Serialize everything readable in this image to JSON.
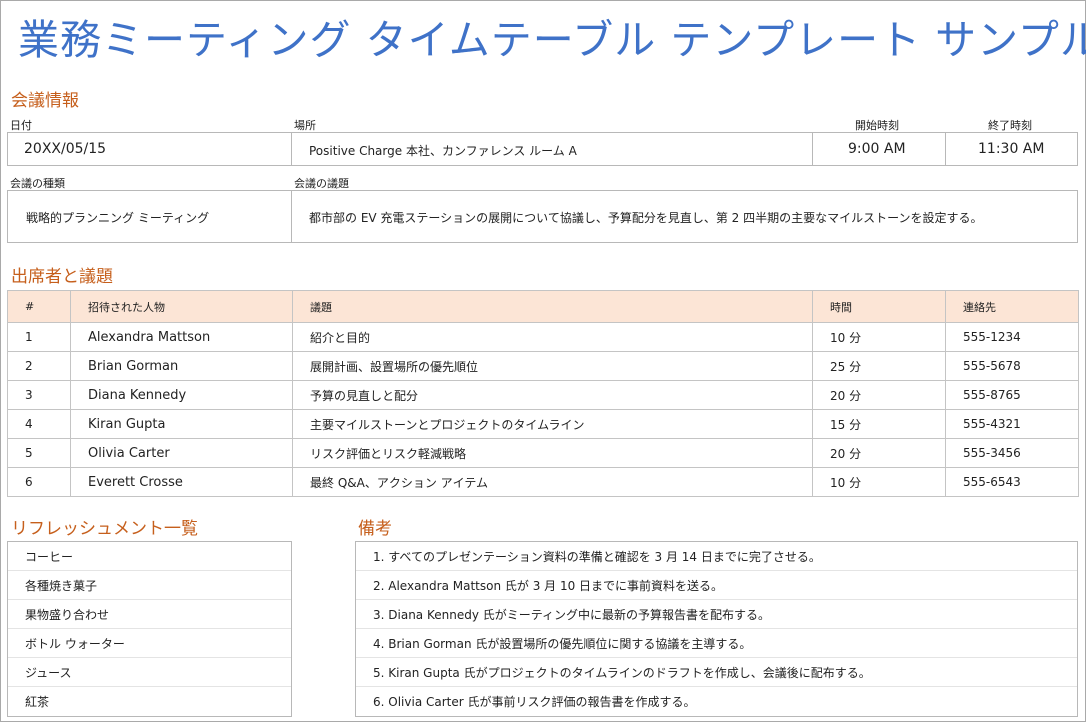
{
  "title": "業務ミーティング タイムテーブル テンプレート サンプル",
  "meeting_info": {
    "heading": "会議情報",
    "date_label": "日付",
    "date": "20XX/05/15",
    "location_label": "場所",
    "location": "Positive Charge 本社、カンファレンス ルーム A",
    "start_label": "開始時刻",
    "start": "9:00 AM",
    "end_label": "終了時刻",
    "end": "11:30 AM",
    "type_label": "会議の種類",
    "type": "戦略的プランニング ミーティング",
    "agenda_label": "会議の議題",
    "agenda": "都市部の EV 充電ステーションの展開について協議し、予算配分を見直し、第 2 四半期の主要なマイルストーンを設定する。"
  },
  "attendees": {
    "heading": "出席者と議題",
    "headers": [
      "#",
      "招待された人物",
      "議題",
      "時間",
      "連絡先"
    ],
    "rows": [
      {
        "num": "1",
        "person": "Alexandra Mattson",
        "topic": "紹介と目的",
        "time": "10 分",
        "contact": "555-1234"
      },
      {
        "num": "2",
        "person": "Brian Gorman",
        "topic": "展開計画、設置場所の優先順位",
        "time": "25 分",
        "contact": "555-5678"
      },
      {
        "num": "3",
        "person": "Diana Kennedy",
        "topic": "予算の見直しと配分",
        "time": "20 分",
        "contact": "555-8765"
      },
      {
        "num": "4",
        "person": "Kiran Gupta",
        "topic": "主要マイルストーンとプロジェクトのタイムライン",
        "time": "15 分",
        "contact": "555-4321"
      },
      {
        "num": "5",
        "person": "Olivia Carter",
        "topic": "リスク評価とリスク軽減戦略",
        "time": "20 分",
        "contact": "555-3456"
      },
      {
        "num": "6",
        "person": "Everett Crosse",
        "topic": "最終 Q&A、アクション アイテム",
        "time": "10 分",
        "contact": "555-6543"
      }
    ]
  },
  "refreshments": {
    "heading": "リフレッシュメント一覧",
    "items": [
      "コーヒー",
      "各種焼き菓子",
      "果物盛り合わせ",
      "ボトル ウォーター",
      "ジュース",
      "紅茶"
    ]
  },
  "notes": {
    "heading": "備考",
    "items": [
      "1. すべてのプレゼンテーション資料の準備と確認を 3 月 14 日までに完了させる。",
      "2. Alexandra Mattson 氏が 3 月 10 日までに事前資料を送る。",
      "3. Diana Kennedy 氏がミーティング中に最新の予算報告書を配布する。",
      "4. Brian Gorman 氏が設置場所の優先順位に関する協議を主導する。",
      "5. Kiran Gupta 氏がプロジェクトのタイムラインのドラフトを作成し、会議後に配布する。",
      "6. Olivia Carter 氏が事前リスク評価の報告書を作成する。"
    ]
  },
  "colors": {
    "title": "#3f72c8",
    "section_heading": "#c65f1c",
    "table_header_bg": "#fce5d6"
  }
}
